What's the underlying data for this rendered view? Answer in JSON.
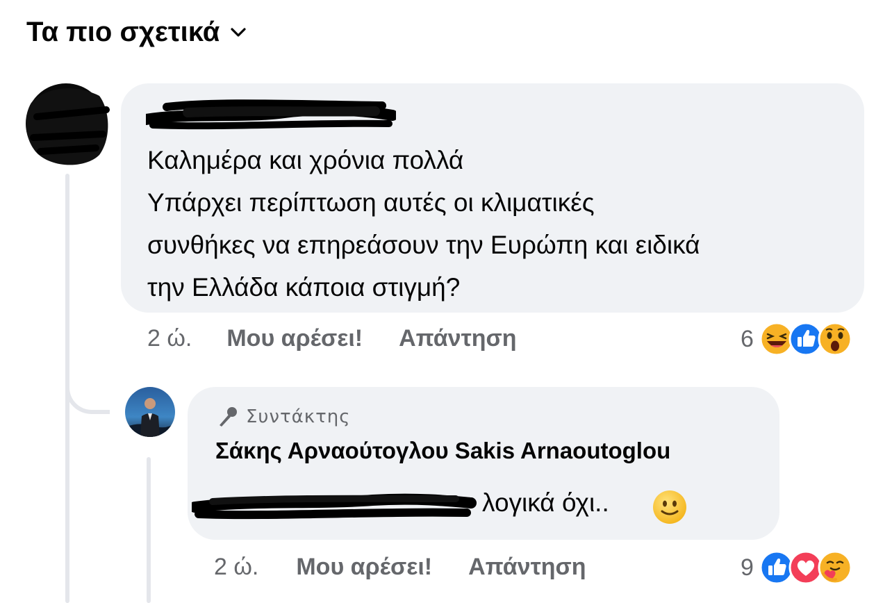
{
  "header": {
    "sort_label": "Τα πιο σχετικά",
    "chevron_icon": "chevron-down-icon"
  },
  "comments": [
    {
      "author_redacted": true,
      "text": "Καλημέρα και χρόνια πολλά\nΥπάρχει περίπτωση αυτές οι κλιματικές\nσυνθήκες να επηρεάσουν την Ευρώπη και ειδικά\nτην Ελλάδα κάποια στιγμή?",
      "time": "2 ώ.",
      "like_label": "Μου αρέσει!",
      "reply_label": "Απάντηση",
      "reaction_count": "6",
      "reactions": [
        "haha-reaction-icon",
        "like-reaction-icon",
        "wow-reaction-icon"
      ]
    }
  ],
  "reply": {
    "badge_icon": "microphone-icon",
    "badge_label": "Συντάκτης",
    "author": "Σάκης Αρναούτογλου Sakis Arnaoutoglou",
    "mention_redacted": true,
    "text": "λογικά όχι..",
    "emoji": "slightly-smiling-emoji",
    "time": "2 ώ.",
    "like_label": "Μου αρέσει!",
    "reply_label": "Απάντηση",
    "reaction_count": "9",
    "reactions": [
      "like-reaction-icon",
      "love-reaction-icon",
      "care-reaction-icon"
    ]
  },
  "colors": {
    "bubble": "#f0f2f5",
    "secondary_text": "#65676b",
    "like_blue": "#1877f2",
    "love_red": "#f33e58",
    "reaction_yellow": "#f7b125"
  }
}
